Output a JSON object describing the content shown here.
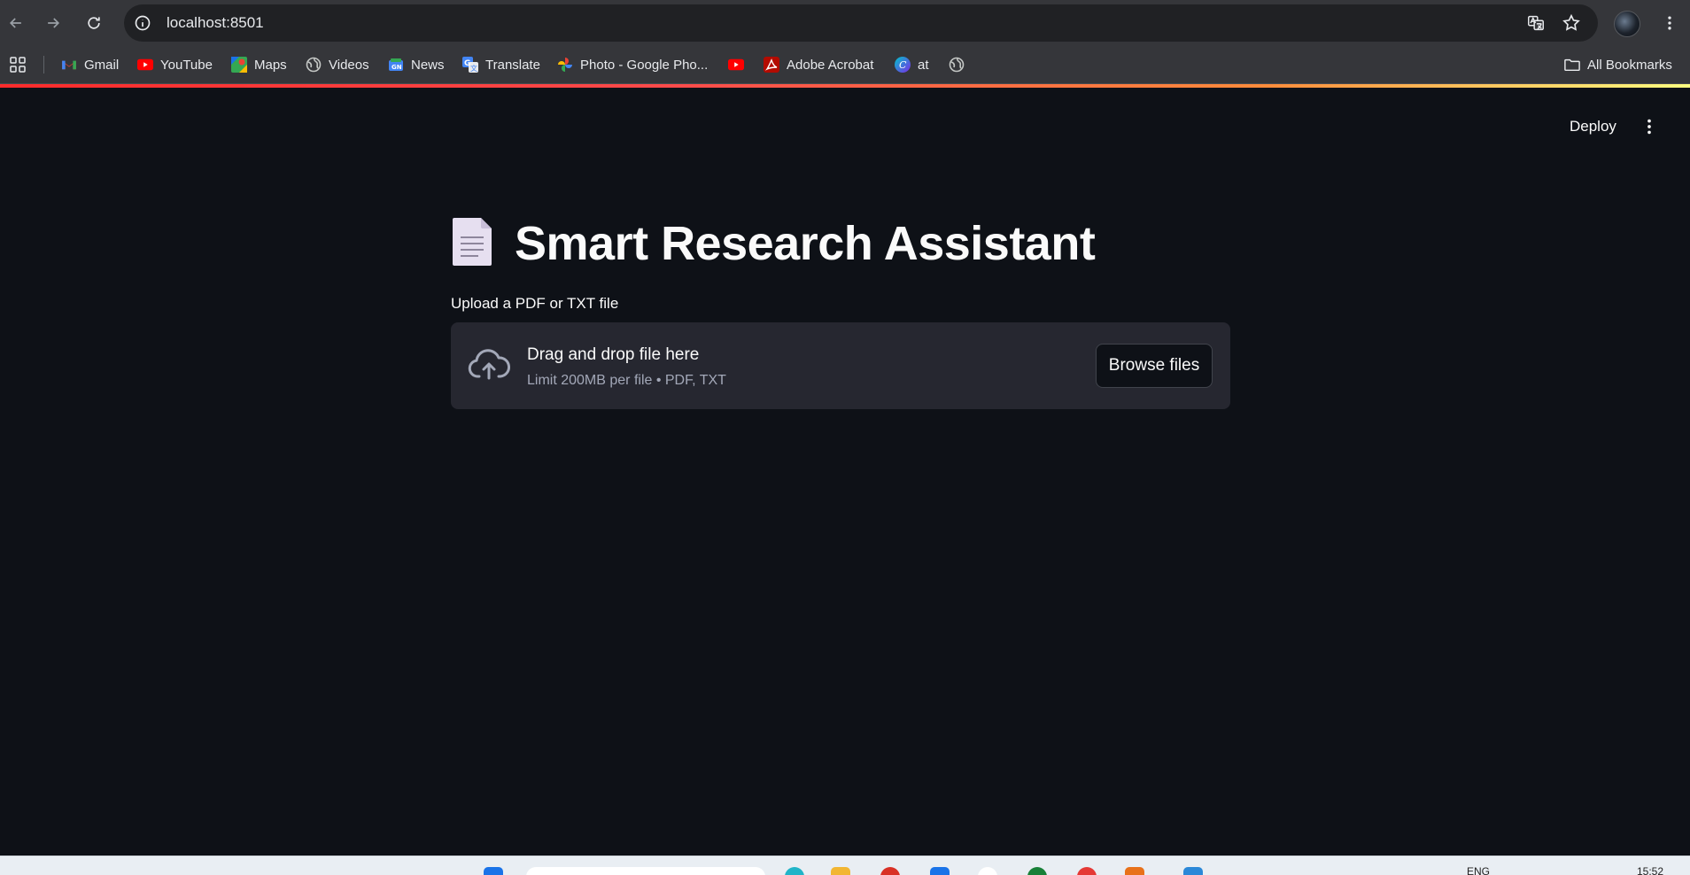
{
  "browser": {
    "url": "localhost:8501",
    "bookmarks": [
      {
        "label": "Gmail",
        "icon": "gmail-icon"
      },
      {
        "label": "YouTube",
        "icon": "youtube-icon"
      },
      {
        "label": "Maps",
        "icon": "maps-icon"
      },
      {
        "label": "Videos",
        "icon": "globe-icon"
      },
      {
        "label": "News",
        "icon": "news-icon"
      },
      {
        "label": "Translate",
        "icon": "translate-icon"
      },
      {
        "label": "Photo - Google Pho...",
        "icon": "photos-icon"
      },
      {
        "label": "",
        "icon": "youtube-icon"
      },
      {
        "label": "Adobe Acrobat",
        "icon": "acrobat-icon"
      },
      {
        "label": "at",
        "icon": "canva-icon"
      },
      {
        "label": "",
        "icon": "globe-icon"
      }
    ],
    "all_bookmarks_label": "All Bookmarks"
  },
  "app": {
    "deploy_label": "Deploy",
    "title": "Smart Research Assistant",
    "title_emoji": "page-document-icon",
    "uploader": {
      "label": "Upload a PDF or TXT file",
      "drop_text": "Drag and drop file here",
      "limit_text": "Limit 200MB per file • PDF, TXT",
      "button_label": "Browse files"
    }
  },
  "taskbar": {
    "lang": "ENG",
    "time": "15:52"
  },
  "colors": {
    "background": "#0e1117",
    "dropzone": "#262730",
    "accent_start": "#ff2b2b",
    "accent_end": "#fffd80"
  }
}
